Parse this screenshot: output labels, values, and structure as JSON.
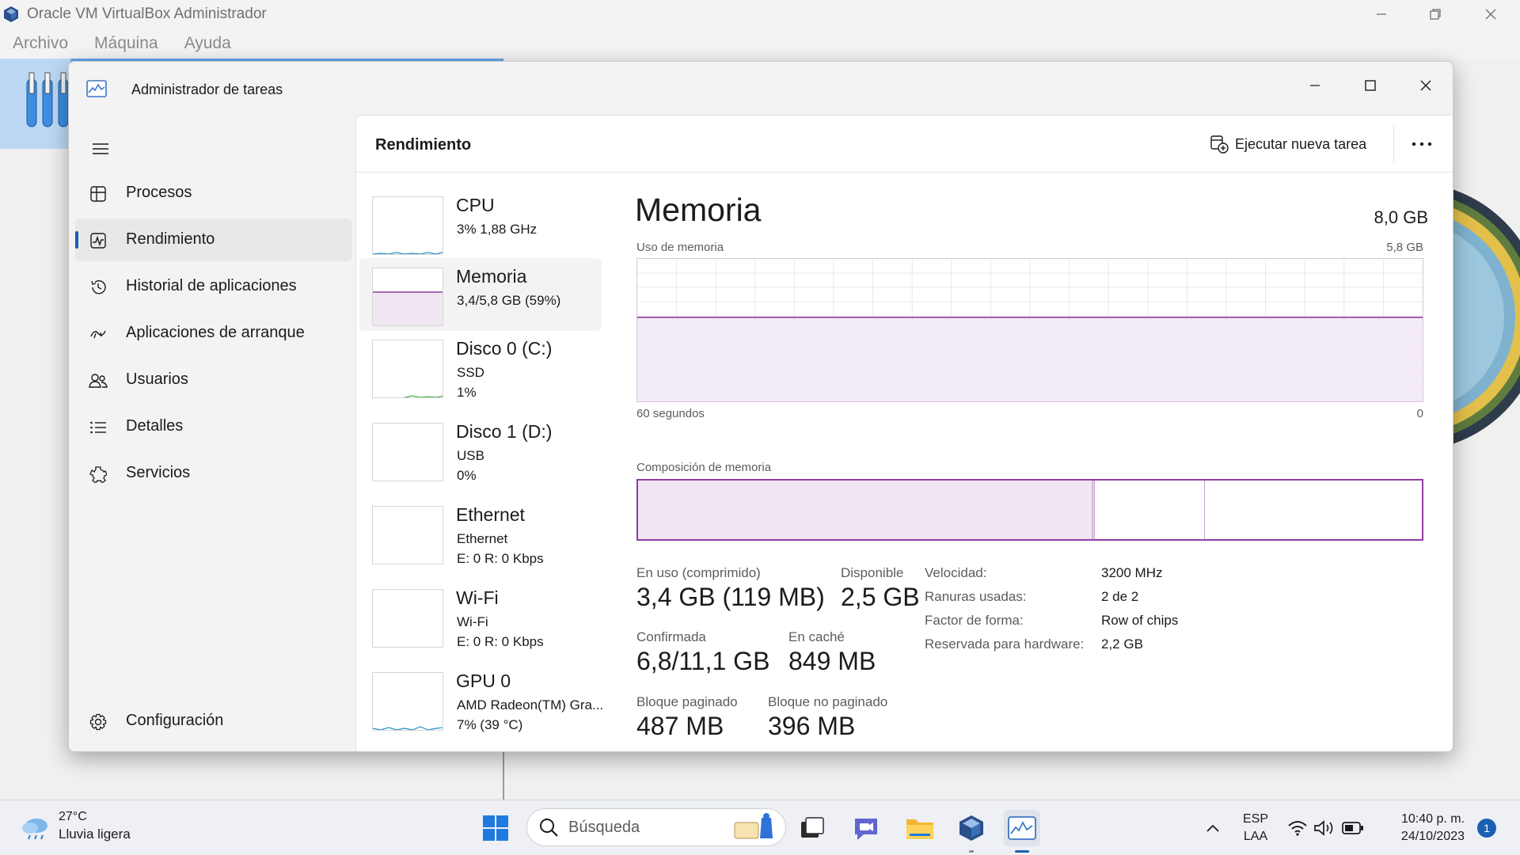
{
  "vbox": {
    "title": "Oracle VM VirtualBox Administrador",
    "menu": [
      "Archivo",
      "Máquina",
      "Ayuda"
    ]
  },
  "taskmanager": {
    "title": "Administrador de tareas",
    "nav": [
      {
        "label": "Procesos",
        "icon": "processes-icon"
      },
      {
        "label": "Rendimiento",
        "icon": "performance-icon",
        "active": true
      },
      {
        "label": "Historial de aplicaciones",
        "icon": "history-icon"
      },
      {
        "label": "Aplicaciones de arranque",
        "icon": "startup-icon"
      },
      {
        "label": "Usuarios",
        "icon": "users-icon"
      },
      {
        "label": "Detalles",
        "icon": "details-icon"
      },
      {
        "label": "Servicios",
        "icon": "services-icon"
      }
    ],
    "settings_label": "Configuración",
    "header": {
      "title": "Rendimiento",
      "run_task": "Ejecutar nueva tarea"
    },
    "devices": [
      {
        "name": "CPU",
        "line1": "3%  1,88 GHz",
        "line2": ""
      },
      {
        "name": "Memoria",
        "line1": "3,4/5,8 GB (59%)",
        "line2": "",
        "active": true
      },
      {
        "name": "Disco 0 (C:)",
        "line1": "SSD",
        "line2": "1%"
      },
      {
        "name": "Disco 1 (D:)",
        "line1": "USB",
        "line2": "0%"
      },
      {
        "name": "Ethernet",
        "line1": "Ethernet",
        "line2": "E: 0  R: 0 Kbps"
      },
      {
        "name": "Wi-Fi",
        "line1": "Wi-Fi",
        "line2": "E: 0  R: 0 Kbps"
      },
      {
        "name": "GPU 0",
        "line1": "AMD Radeon(TM) Gra...",
        "line2": "7% (39 °C)"
      }
    ],
    "memory": {
      "title": "Memoria",
      "total": "8,0 GB",
      "usage_label": "Uso de memoria",
      "usage_max": "5,8 GB",
      "time_label": "60 segundos",
      "time_end": "0",
      "usage_fraction": 0.59,
      "composition_label": "Composición de memoria",
      "composition": {
        "in_use_fraction": 0.58,
        "modified_fraction": 0.003,
        "standby_fraction": 0.14
      },
      "stats": {
        "in_use_label": "En uso (comprimido)",
        "in_use_value": "3,4 GB (119 MB)",
        "available_label": "Disponible",
        "available_value": "2,5 GB",
        "committed_label": "Confirmada",
        "committed_value": "6,8/11,1 GB",
        "cached_label": "En caché",
        "cached_value": "849 MB",
        "paged_label": "Bloque paginado",
        "paged_value": "487 MB",
        "nonpaged_label": "Bloque no paginado",
        "nonpaged_value": "396 MB"
      },
      "details": [
        {
          "label": "Velocidad:",
          "value": "3200 MHz"
        },
        {
          "label": "Ranuras usadas:",
          "value": "2 de 2"
        },
        {
          "label": "Factor de forma:",
          "value": "Row of chips"
        },
        {
          "label": "Reservada para hardware:",
          "value": "2,2 GB"
        }
      ]
    }
  },
  "taskbar": {
    "weather_temp": "27°C",
    "weather_cond": "Lluvia ligera",
    "search_placeholder": "Búsqueda",
    "lang_1": "ESP",
    "lang_2": "LAA",
    "time": "10:40 p. m.",
    "date": "24/10/2023",
    "notifications": "1"
  },
  "colors": {
    "memory_accent": "#8e3ea3",
    "memory_fill": "#f1e7f3",
    "selection_blue": "#1a5fb4",
    "cpu_line": "#1e90c8",
    "disk_line": "#4caf50",
    "gpu_line": "#1e90c8"
  }
}
